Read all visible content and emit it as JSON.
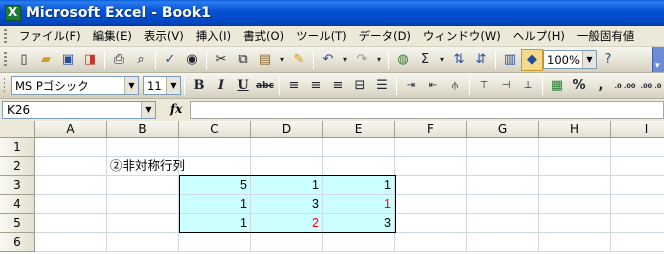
{
  "window": {
    "title": "Microsoft Excel - Book1"
  },
  "menu": [
    "ファイル(F)",
    "編集(E)",
    "表示(V)",
    "挿入(I)",
    "書式(O)",
    "ツール(T)",
    "データ(D)",
    "ウィンドウ(W)",
    "ヘルプ(H)",
    "一般固有値"
  ],
  "toolbar": {
    "zoom": "100%",
    "font_name": "MS Pゴシック",
    "font_size": "11",
    "bold": "B",
    "italic": "I",
    "underline": "U",
    "strike": "abc",
    "percent": "%",
    "comma": ",",
    "inc_decimal": ".0 .00",
    "dec_decimal": ".00 .0"
  },
  "formula_bar": {
    "name_box": "K26",
    "fx": "fx",
    "content": ""
  },
  "sheet": {
    "columns": [
      "A",
      "B",
      "C",
      "D",
      "E",
      "F",
      "G",
      "H",
      "I"
    ],
    "rows": [
      "1",
      "2",
      "3",
      "4",
      "5",
      "6"
    ],
    "b2_text": "②非対称行列",
    "matrix": [
      [
        {
          "v": "5",
          "red": false
        },
        {
          "v": "1",
          "red": false
        },
        {
          "v": "1",
          "red": false
        }
      ],
      [
        {
          "v": "1",
          "red": false
        },
        {
          "v": "3",
          "red": false
        },
        {
          "v": "1",
          "red": true
        }
      ],
      [
        {
          "v": "1",
          "red": false
        },
        {
          "v": "2",
          "red": true
        },
        {
          "v": "3",
          "red": false
        }
      ]
    ],
    "highlight_color": "#CCFFFF",
    "accent_red": "#FF0000"
  }
}
